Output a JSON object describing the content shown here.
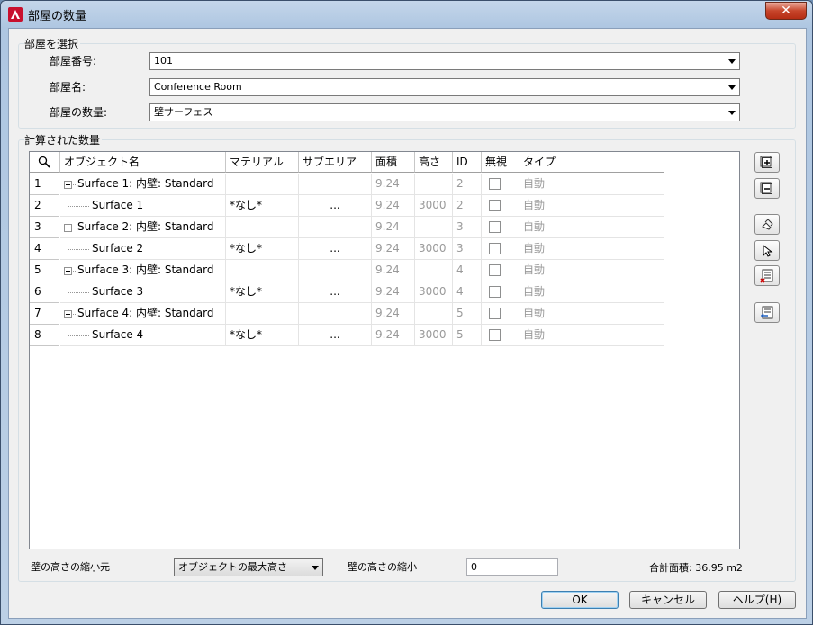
{
  "window": {
    "title": "部屋の数量",
    "close_label": "✕"
  },
  "room_select": {
    "group_label": "部屋を選択",
    "number_label": "部屋番号:",
    "number_value": "101",
    "name_label": "部屋名:",
    "name_value": "Conference Room",
    "quantity_label": "部屋の数量:",
    "quantity_value": "壁サーフェス"
  },
  "quantities": {
    "group_label": "計算された数量",
    "columns": [
      "オブジェクト名",
      "マテリアル",
      "サブエリア",
      "面積",
      "高さ",
      "ID",
      "無視",
      "タイプ"
    ],
    "rows": [
      {
        "num": "1",
        "name": "Surface 1: 内壁: Standard",
        "material": "",
        "subarea": "",
        "area": "9.24",
        "height": "",
        "id": "2",
        "type": "自動"
      },
      {
        "num": "2",
        "name": "Surface 1",
        "material": "*なし*",
        "subarea": "...",
        "area": "9.24",
        "height": "3000",
        "id": "2",
        "type": "自動"
      },
      {
        "num": "3",
        "name": "Surface 2: 内壁: Standard",
        "material": "",
        "subarea": "",
        "area": "9.24",
        "height": "",
        "id": "3",
        "type": "自動"
      },
      {
        "num": "4",
        "name": "Surface 2",
        "material": "*なし*",
        "subarea": "...",
        "area": "9.24",
        "height": "3000",
        "id": "3",
        "type": "自動"
      },
      {
        "num": "5",
        "name": "Surface 3: 内壁: Standard",
        "material": "",
        "subarea": "",
        "area": "9.24",
        "height": "",
        "id": "4",
        "type": "自動"
      },
      {
        "num": "6",
        "name": "Surface 3",
        "material": "*なし*",
        "subarea": "...",
        "area": "9.24",
        "height": "3000",
        "id": "4",
        "type": "自動"
      },
      {
        "num": "7",
        "name": "Surface 4: 内壁: Standard",
        "material": "",
        "subarea": "",
        "area": "9.24",
        "height": "",
        "id": "5",
        "type": "自動"
      },
      {
        "num": "8",
        "name": "Surface 4",
        "material": "*なし*",
        "subarea": "...",
        "area": "9.24",
        "height": "3000",
        "id": "5",
        "type": "自動"
      }
    ]
  },
  "footer": {
    "height_source_label": "壁の高さの縮小元",
    "height_source_value": "オブジェクトの最大高さ",
    "height_reduce_label": "壁の高さの縮小",
    "height_reduce_value": "0",
    "total_area_label": "合計面積: 36.95 m2"
  },
  "buttons": {
    "ok": "OK",
    "cancel": "キャンセル",
    "help": "ヘルプ(H)"
  },
  "icons": {
    "app": "autocad-icon",
    "side": [
      "expand-all-icon",
      "collapse-all-icon",
      "select-objects-icon",
      "pick-icon",
      "delete-rows-icon",
      "import-icon"
    ]
  },
  "colors": {
    "title_accent": "#c8102e",
    "grid_gray_text": "#9a9a9a"
  }
}
